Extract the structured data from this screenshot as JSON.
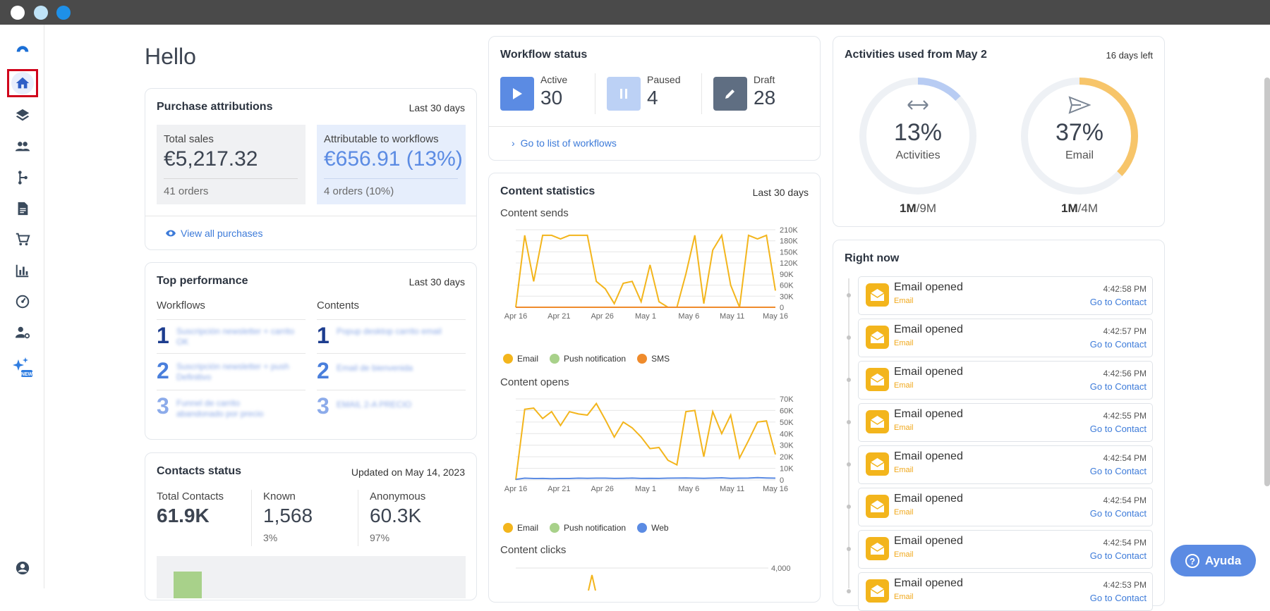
{
  "greeting": "Hello",
  "purchase": {
    "title": "Purchase attributions",
    "range": "Last 30 days",
    "total_label": "Total sales",
    "total_value": "€5,217.32",
    "total_orders": "41 orders",
    "attr_label": "Attributable to workflows",
    "attr_value": "€656.91 (13%)",
    "attr_orders": "4 orders (10%)",
    "view_all": "View all purchases"
  },
  "top": {
    "title": "Top performance",
    "range": "Last 30 days",
    "workflows_label": "Workflows",
    "contents_label": "Contents",
    "workflows": [
      {
        "rank": "1",
        "name": "Suscripción newsletter + carrito OK"
      },
      {
        "rank": "2",
        "name": "Suscripción newsletter + push Definitivo"
      },
      {
        "rank": "3",
        "name": "Funnel de carrito abandonado por precio"
      }
    ],
    "contents": [
      {
        "rank": "1",
        "name": "Popup desktop carrito email"
      },
      {
        "rank": "2",
        "name": "Email de bienvenida"
      },
      {
        "rank": "3",
        "name": "EMAIL 2-A PRECIO"
      }
    ]
  },
  "contacts": {
    "title": "Contacts status",
    "updated": "Updated on May 14, 2023",
    "total_label": "Total Contacts",
    "total_value": "61.9K",
    "known_label": "Known",
    "known_value": "1,568",
    "known_pct": "3%",
    "anon_label": "Anonymous",
    "anon_value": "60.3K",
    "anon_pct": "97%"
  },
  "workflow": {
    "title": "Workflow status",
    "active_label": "Active",
    "active_value": "30",
    "paused_label": "Paused",
    "paused_value": "4",
    "draft_label": "Draft",
    "draft_value": "28",
    "goto": "Go to list of workflows"
  },
  "content": {
    "title": "Content statistics",
    "range": "Last 30 days",
    "sends_title": "Content sends",
    "opens_title": "Content opens",
    "clicks_title": "Content clicks",
    "legend_sends": [
      {
        "name": "Email",
        "color": "#f3b51c"
      },
      {
        "name": "Push notification",
        "color": "#a8d18a"
      },
      {
        "name": "SMS",
        "color": "#ef8b2c"
      }
    ],
    "legend_opens": [
      {
        "name": "Email",
        "color": "#f3b51c"
      },
      {
        "name": "Push notification",
        "color": "#a8d18a"
      },
      {
        "name": "Web",
        "color": "#5b8be3"
      }
    ],
    "clicks_top_tick": "4,000"
  },
  "chart_data": [
    {
      "type": "line",
      "title": "Content sends",
      "x": [
        "Apr 16",
        "Apr 21",
        "Apr 26",
        "May 1",
        "May 6",
        "May 11",
        "May 16"
      ],
      "yticks": [
        "210K",
        "180K",
        "150K",
        "120K",
        "90K",
        "60K",
        "30K",
        "0"
      ],
      "ylim": [
        0,
        210000
      ],
      "series": [
        {
          "name": "Email",
          "values": [
            0,
            195000,
            70000,
            195000,
            195000,
            185000,
            195000,
            195000,
            195000,
            70000,
            50000,
            10000,
            65000,
            70000,
            15000,
            115000,
            15000,
            0,
            0,
            90000,
            195000,
            10000,
            155000,
            195000,
            60000,
            0,
            195000,
            185000,
            195000,
            45000
          ]
        },
        {
          "name": "SMS",
          "values": [
            0,
            0,
            0,
            0,
            0,
            0,
            0,
            0,
            0,
            0,
            0,
            0,
            0,
            0,
            0,
            0,
            0,
            0,
            0,
            0,
            0,
            0,
            0,
            0,
            0,
            0,
            0,
            0,
            0,
            0
          ]
        }
      ]
    },
    {
      "type": "line",
      "title": "Content opens",
      "x": [
        "Apr 16",
        "Apr 21",
        "Apr 26",
        "May 1",
        "May 6",
        "May 11",
        "May 16"
      ],
      "yticks": [
        "70K",
        "60K",
        "50K",
        "40K",
        "30K",
        "20K",
        "10K",
        "0"
      ],
      "ylim": [
        0,
        70000
      ],
      "series": [
        {
          "name": "Email",
          "values": [
            0,
            61000,
            62000,
            53000,
            59000,
            47000,
            59000,
            57000,
            56000,
            66000,
            52000,
            37000,
            50000,
            45000,
            37000,
            27000,
            28000,
            17000,
            13000,
            59000,
            60000,
            20000,
            59000,
            40000,
            56000,
            19000,
            34000,
            50000,
            51000,
            22000
          ]
        },
        {
          "name": "Web",
          "values": [
            500,
            1500,
            1200,
            1300,
            1100,
            1200,
            1200,
            1500,
            1400,
            1500,
            1500,
            1300,
            1400,
            1600,
            1300,
            1400,
            1300,
            1500,
            1600,
            1700,
            1500,
            1400,
            1600,
            1800,
            1400,
            1500,
            1600,
            2000,
            1700,
            1500
          ]
        }
      ]
    }
  ],
  "activities": {
    "title": "Activities used from May 2",
    "days_left": "16 days left",
    "act_pct": "13%",
    "act_label": "Activities",
    "act_used": "1M",
    "act_total": "/9M",
    "act_fraction": 0.13,
    "email_pct": "37%",
    "email_label": "Email",
    "email_used": "1M",
    "email_total": "/4M",
    "email_fraction": 0.37
  },
  "rightnow": {
    "title": "Right now",
    "events": [
      {
        "title": "Email opened",
        "sub": "Email",
        "time": "4:42:58 PM",
        "link": "Go to Contact"
      },
      {
        "title": "Email opened",
        "sub": "Email",
        "time": "4:42:57 PM",
        "link": "Go to Contact"
      },
      {
        "title": "Email opened",
        "sub": "Email",
        "time": "4:42:56 PM",
        "link": "Go to Contact"
      },
      {
        "title": "Email opened",
        "sub": "Email",
        "time": "4:42:55 PM",
        "link": "Go to Contact"
      },
      {
        "title": "Email opened",
        "sub": "Email",
        "time": "4:42:54 PM",
        "link": "Go to Contact"
      },
      {
        "title": "Email opened",
        "sub": "Email",
        "time": "4:42:54 PM",
        "link": "Go to Contact"
      },
      {
        "title": "Email opened",
        "sub": "Email",
        "time": "4:42:54 PM",
        "link": "Go to Contact"
      },
      {
        "title": "Email opened",
        "sub": "Email",
        "time": "4:42:53 PM",
        "link": "Go to Contact"
      }
    ]
  },
  "help": {
    "label": "Ayuda"
  },
  "sidebar": {
    "new_badge": "NEW"
  },
  "colors": {
    "accent": "#5b8be3",
    "email": "#f3b51c",
    "sms": "#ef8b2c",
    "selected_outline": "#d0021b"
  }
}
